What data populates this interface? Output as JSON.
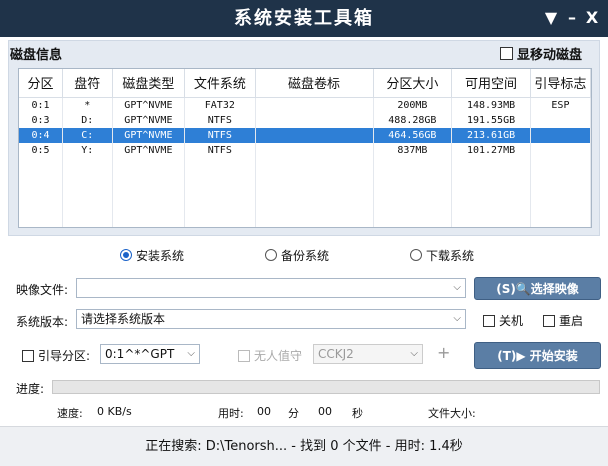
{
  "window": {
    "title": "系统安装工具箱",
    "menu_glyph": "▼",
    "minimize_glyph": "–",
    "close_glyph": "X"
  },
  "disk_panel": {
    "label": "磁盘信息",
    "show_removable_label": "显移动磁盘",
    "columns": [
      "分区",
      "盘符",
      "磁盘类型",
      "文件系统",
      "磁盘卷标",
      "分区大小",
      "可用空间",
      "引导标志"
    ],
    "rows": [
      [
        "0:1",
        "*",
        "GPT^NVME",
        "FAT32",
        "",
        "200MB",
        "148.93MB",
        "ESP"
      ],
      [
        "0:3",
        "D:",
        "GPT^NVME",
        "NTFS",
        "",
        "488.28GB",
        "191.55GB",
        ""
      ],
      [
        "0:4",
        "C:",
        "GPT^NVME",
        "NTFS",
        "",
        "464.56GB",
        "213.61GB",
        ""
      ],
      [
        "0:5",
        "Y:",
        "GPT^NVME",
        "NTFS",
        "",
        "837MB",
        "101.27MB",
        ""
      ]
    ],
    "selected_row": 2
  },
  "modes": {
    "install": "安装系统",
    "backup": "备份系统",
    "download": "下载系统",
    "selected": "install"
  },
  "image": {
    "label": "映像文件:",
    "value": "",
    "button": "(S)🔍选择映像"
  },
  "version": {
    "label": "系统版本:",
    "value": "请选择系统版本",
    "shutdown": "关机",
    "restart": "重启"
  },
  "boot": {
    "label": "引导分区:",
    "value": "0:1^*^GPT",
    "unattended": "无人值守",
    "unattended_value": "CCKJ2",
    "plus": "+",
    "start_button": "(T)▶ 开始安装"
  },
  "progress": {
    "label": "进度:",
    "value": 0
  },
  "stats": {
    "speed_label": "速度:",
    "speed_value": "0 KB/s",
    "time_label": "用时:",
    "minutes": "00",
    "minutes_unit": "分",
    "seconds": "00",
    "seconds_unit": "秒",
    "filesize_label": "文件大小:"
  },
  "status": {
    "text": "正在搜索: D:\\Tenorsh... - 找到 0 个文件 - 用时: 1.4秒"
  }
}
